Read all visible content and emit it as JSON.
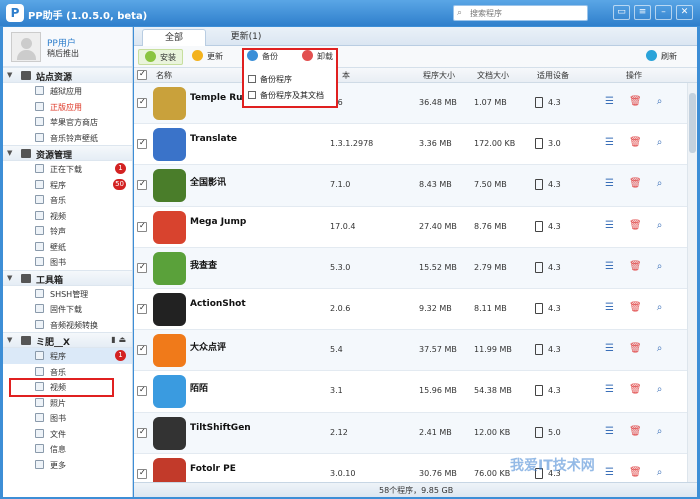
{
  "window": {
    "title": "PP助手 (1.0.5.0, beta)",
    "logo": "P"
  },
  "search": {
    "placeholder": "搜索程序"
  },
  "user": {
    "name": "PP用户",
    "logout": "稍后推出"
  },
  "sidebar": {
    "sections": [
      {
        "title": "站点资源",
        "items": [
          {
            "label": "越狱应用"
          },
          {
            "label": "正版应用"
          },
          {
            "label": "苹果官方商店"
          },
          {
            "label": "音乐铃声壁纸"
          }
        ]
      },
      {
        "title": "资源管理",
        "items": [
          {
            "label": "正在下载",
            "badge": "1"
          },
          {
            "label": "程序",
            "badge": "50"
          },
          {
            "label": "音乐"
          },
          {
            "label": "视频"
          },
          {
            "label": "铃声"
          },
          {
            "label": "壁纸"
          },
          {
            "label": "图书"
          }
        ]
      },
      {
        "title": "工具箱",
        "items": [
          {
            "label": "SHSH管理"
          },
          {
            "label": "固件下载"
          },
          {
            "label": "音频视频转换"
          }
        ]
      },
      {
        "title": "ミ肥__X",
        "items": [
          {
            "label": "程序",
            "badge": "1"
          },
          {
            "label": "音乐"
          },
          {
            "label": "视频"
          },
          {
            "label": "照片"
          },
          {
            "label": "图书"
          },
          {
            "label": "文件"
          },
          {
            "label": "信息"
          },
          {
            "label": "更多"
          }
        ]
      }
    ]
  },
  "tabs": [
    {
      "label": "全部"
    },
    {
      "label": "更新(1)"
    }
  ],
  "toolbar": {
    "install": "安装",
    "update": "更新",
    "backup": "备份",
    "uninstall": "卸载",
    "refresh": "刷新"
  },
  "backup_menu": {
    "items": [
      "备份程序",
      "备份程序及其文档"
    ]
  },
  "columns": {
    "name": "名称",
    "version": "本",
    "app_size": "程序大小",
    "doc_size": "文档大小",
    "device": "适用设备",
    "actions": "操作"
  },
  "apps": [
    {
      "name": "Temple Run",
      "version": "1.6",
      "app_size": "36.48 MB",
      "doc_size": "1.07 MB",
      "device": "4.3",
      "color": "#c9a13b"
    },
    {
      "name": "Translate",
      "version": "1.3.1.2978",
      "app_size": "3.36 MB",
      "doc_size": "172.00 KB",
      "device": "3.0",
      "color": "#3a73c9"
    },
    {
      "name": "全国影讯",
      "version": "7.1.0",
      "app_size": "8.43 MB",
      "doc_size": "7.50 MB",
      "device": "4.3",
      "color": "#4a7d2a"
    },
    {
      "name": "Mega Jump",
      "version": "17.0.4",
      "app_size": "27.40 MB",
      "doc_size": "8.76 MB",
      "device": "4.3",
      "color": "#d8432e"
    },
    {
      "name": "我查查",
      "version": "5.3.0",
      "app_size": "15.52 MB",
      "doc_size": "2.79 MB",
      "device": "4.3",
      "color": "#5aa13a"
    },
    {
      "name": "ActionShot",
      "version": "2.0.6",
      "app_size": "9.32 MB",
      "doc_size": "8.11 MB",
      "device": "4.3",
      "color": "#222222"
    },
    {
      "name": "大众点评",
      "version": "5.4",
      "app_size": "37.57 MB",
      "doc_size": "11.99 MB",
      "device": "4.3",
      "color": "#f07a1a"
    },
    {
      "name": "陌陌",
      "version": "3.1",
      "app_size": "15.96 MB",
      "doc_size": "54.38 MB",
      "device": "4.3",
      "color": "#3a9be0"
    },
    {
      "name": "TiltShiftGen",
      "version": "2.12",
      "app_size": "2.41 MB",
      "doc_size": "12.00 KB",
      "device": "5.0",
      "color": "#333333"
    },
    {
      "name": "Fotolr PE",
      "version": "3.0.10",
      "app_size": "30.76 MB",
      "doc_size": "76.00 KB",
      "device": "4.3",
      "color": "#c23a2a"
    }
  ],
  "status": {
    "text": "58个程序，9.85 GB"
  },
  "watermark": "我爱IT技术网"
}
